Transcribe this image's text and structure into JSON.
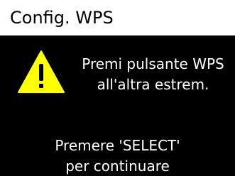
{
  "header": {
    "title": "Config. WPS"
  },
  "dialog": {
    "icon": "warning-icon",
    "message_line1": "Premi pulsante WPS",
    "message_line2": "all'altra estrem.",
    "prompt_line1": "Premere 'SELECT'",
    "prompt_line2": "per continuare"
  },
  "colors": {
    "background": "#000000",
    "title_bar": "#ffffff",
    "text": "#ffffff",
    "warning_fill": "#ffff00"
  }
}
